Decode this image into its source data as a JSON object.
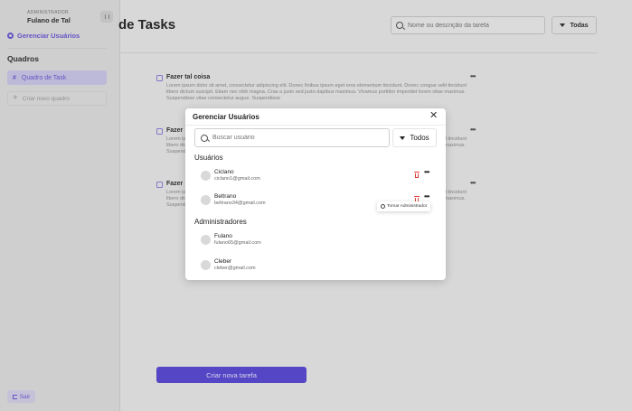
{
  "sidebar": {
    "role": "ADMINISTRADOR",
    "user_name": "Fulano de Tal",
    "manage_users_label": "Gerenciar Usuários",
    "boards_title": "Quadros",
    "boards": [
      {
        "label": "Quadro de Task",
        "active": true
      }
    ],
    "new_board_label": "Criar novo quadro",
    "logout_label": "Sair"
  },
  "header": {
    "title": "de Tasks",
    "search_placeholder": "Nome ou descrição da tarefa",
    "filter_label": "Todas"
  },
  "tasks": [
    {
      "title": "Fazer tal coisa",
      "description": "Lorem ipsum dolor sit amet, consectetur adipiscing elit. Donec finibus ipsum eget eros elementum tincidunt. Donec congue velit tincidunt libero dictum suscipit. Etiam nec nibh magna. Cras a justo sed justo dapibus maximus. Vivamus porttitor imperdiet lorem vitae maximus. Suspendisse vitae consectetur augue. Suspendisse"
    },
    {
      "title": "Fazer",
      "description": "Lorem ipsum dolor sit amet, consectetur adipiscing elit. Donec finibus ipsum eget eros elementum tincidunt. Donec congue velit tincidunt libero dictum suscipit. Etiam nec nibh magna. Cras a justo sed justo dapibus maximus. Vivamus porttitor imperdiet lorem vitae maximus. Suspendisse"
    },
    {
      "title": "Fazer",
      "description": "Lorem ipsum dolor sit amet, consectetur adipiscing elit. Donec finibus ipsum eget eros elementum tincidunt. Donec congue velit tincidunt libero dictum suscipit. Etiam nec nibh magna. Cras a justo sed justo dapibus maximus. Vivamus porttitor imperdiet lorem vitae maximus. Suspendisse"
    }
  ],
  "create_task_label": "Criar nova tarefa",
  "modal": {
    "title": "Gerenciar Usuários",
    "search_placeholder": "Buscar usuário",
    "filter_label": "Todos",
    "users_title": "Usuários",
    "users": [
      {
        "name": "Ciclano",
        "email": "ciclano1@gmail.com"
      },
      {
        "name": "Beltrano",
        "email": "beltrano34@gmail.com"
      }
    ],
    "admins_title": "Administradores",
    "admins": [
      {
        "name": "Fulano",
        "email": "fulano65@gmail.com"
      },
      {
        "name": "Cleber",
        "email": "cleber@gmail.com"
      }
    ],
    "tooltip_label": "Tornar Administrador"
  },
  "colors": {
    "accent": "#5a4bd1",
    "danger": "#e0403a",
    "sidebar_bg": "#dcdcdc"
  }
}
